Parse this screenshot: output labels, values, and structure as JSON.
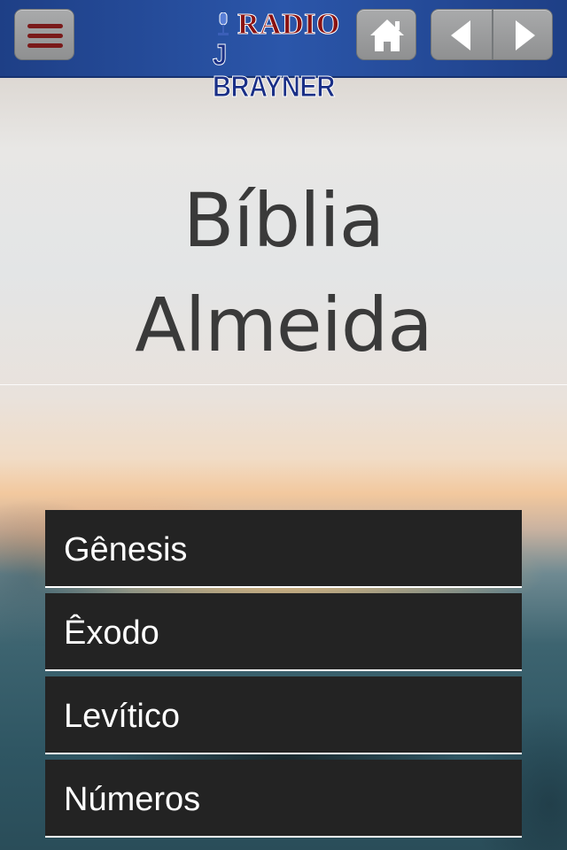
{
  "header": {
    "logo": {
      "line1": "RADIO",
      "line2": "J BRAYNER"
    },
    "menu_icon": "hamburger-menu-icon",
    "home_icon": "home-icon",
    "back_icon": "triangle-left-icon",
    "forward_icon": "triangle-right-icon"
  },
  "page": {
    "title_line1": "Bíblia",
    "title_line2": "Almeida"
  },
  "books": [
    {
      "label": "Gênesis"
    },
    {
      "label": "Êxodo"
    },
    {
      "label": "Levítico"
    },
    {
      "label": "Números"
    }
  ],
  "colors": {
    "header_bg": "#2b56aa",
    "button_bg": "#9a9b9c",
    "menu_bar": "#7a1a1a",
    "list_item_bg": "#232323",
    "list_item_text": "#ffffff",
    "title_text": "#3a3a3a"
  }
}
